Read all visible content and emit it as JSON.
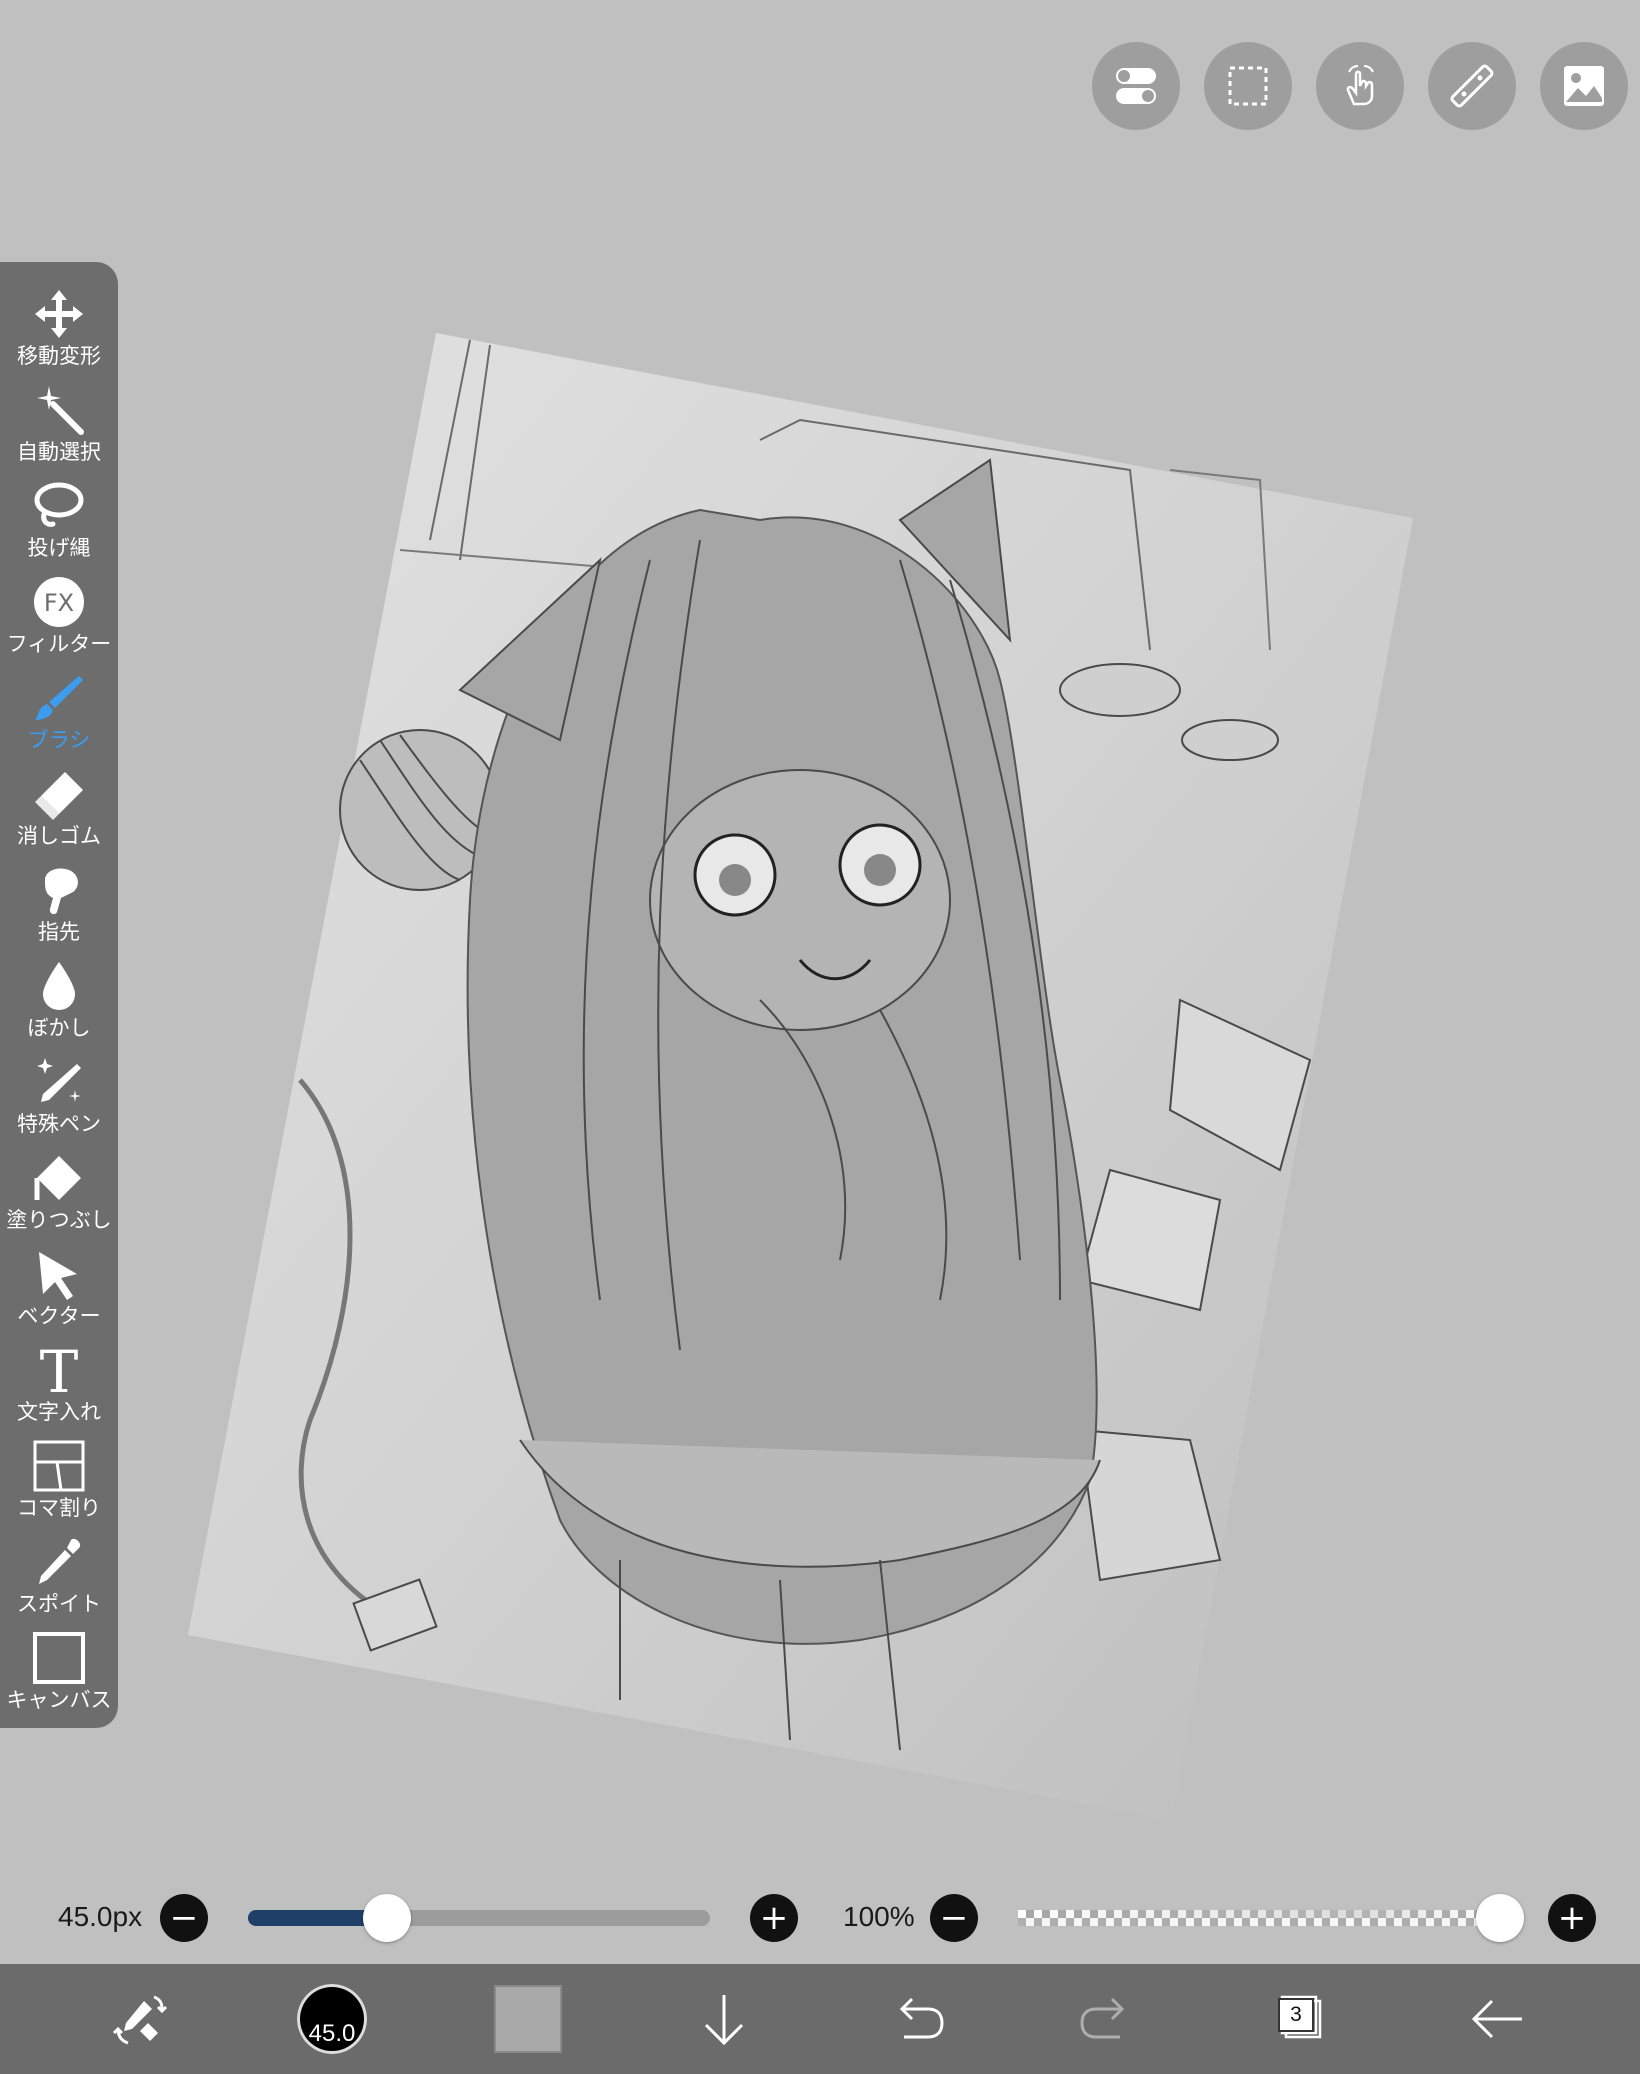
{
  "top_toolbar": {
    "buttons": [
      {
        "name": "toggle-icon"
      },
      {
        "name": "selection-icon"
      },
      {
        "name": "hand-gesture-icon"
      },
      {
        "name": "ruler-icon"
      },
      {
        "name": "image-icon"
      }
    ]
  },
  "tools": [
    {
      "label": "移動変形",
      "icon": "move-icon"
    },
    {
      "label": "自動選択",
      "icon": "magic-wand-icon"
    },
    {
      "label": "投げ縄",
      "icon": "lasso-icon"
    },
    {
      "label": "フィルター",
      "icon": "fx-icon"
    },
    {
      "label": "ブラシ",
      "icon": "brush-icon"
    },
    {
      "label": "消しゴム",
      "icon": "eraser-icon"
    },
    {
      "label": "指先",
      "icon": "smudge-finger-icon"
    },
    {
      "label": "ぼかし",
      "icon": "blur-drop-icon"
    },
    {
      "label": "特殊ペン",
      "icon": "special-pen-icon"
    },
    {
      "label": "塗りつぶし",
      "icon": "fill-bucket-icon"
    },
    {
      "label": "ベクター",
      "icon": "vector-arrow-icon"
    },
    {
      "label": "文字入れ",
      "icon": "text-t-icon"
    },
    {
      "label": "コマ割り",
      "icon": "frame-divider-icon"
    },
    {
      "label": "スポイト",
      "icon": "eyedropper-icon"
    },
    {
      "label": "キャンバス",
      "icon": "canvas-square-icon"
    }
  ],
  "active_tool": "ブラシ",
  "brush": {
    "size_label": "45.0px",
    "size_fraction": 0.3,
    "preview_value": "45.0",
    "opacity_label": "100%",
    "opacity_fraction": 1.0,
    "minus": "−",
    "plus": "+"
  },
  "bottom_bar": {
    "layers_count": "3"
  },
  "colors": {
    "background": "#c0c0c0",
    "toolbar": "#6d6d6d",
    "active_tool": "#3b9cf0",
    "slider_fill": "#1f3f66",
    "bottom_bar": "#6b6b6b",
    "current_color": "#a9a9a9"
  }
}
